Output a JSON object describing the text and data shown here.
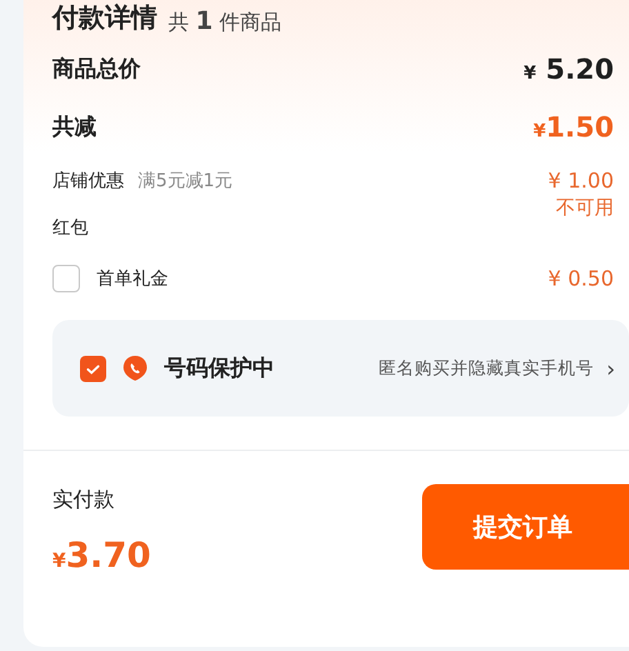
{
  "header": {
    "title": "付款详情",
    "count_prefix": "共",
    "count": "1",
    "count_suffix": "件商品"
  },
  "total": {
    "label": "商品总价",
    "currency": "¥",
    "amount": "5.20"
  },
  "discount": {
    "label": "共减",
    "currency": "¥",
    "amount": "1.50"
  },
  "store_promo": {
    "label": "店铺优惠",
    "note": "满5元减1元",
    "value": "¥ 1.00"
  },
  "red_packet": {
    "label": "红包",
    "status": "不可用"
  },
  "first_order_gift": {
    "label": "首单礼金",
    "checked": false,
    "value": "¥ 0.50"
  },
  "number_protection": {
    "checked": true,
    "title": "号码保护中",
    "description": "匿名购买并隐藏真实手机号",
    "arrow": "›"
  },
  "footer": {
    "label": "实付款",
    "currency": "¥",
    "amount": "3.70",
    "submit": "提交订单"
  }
}
